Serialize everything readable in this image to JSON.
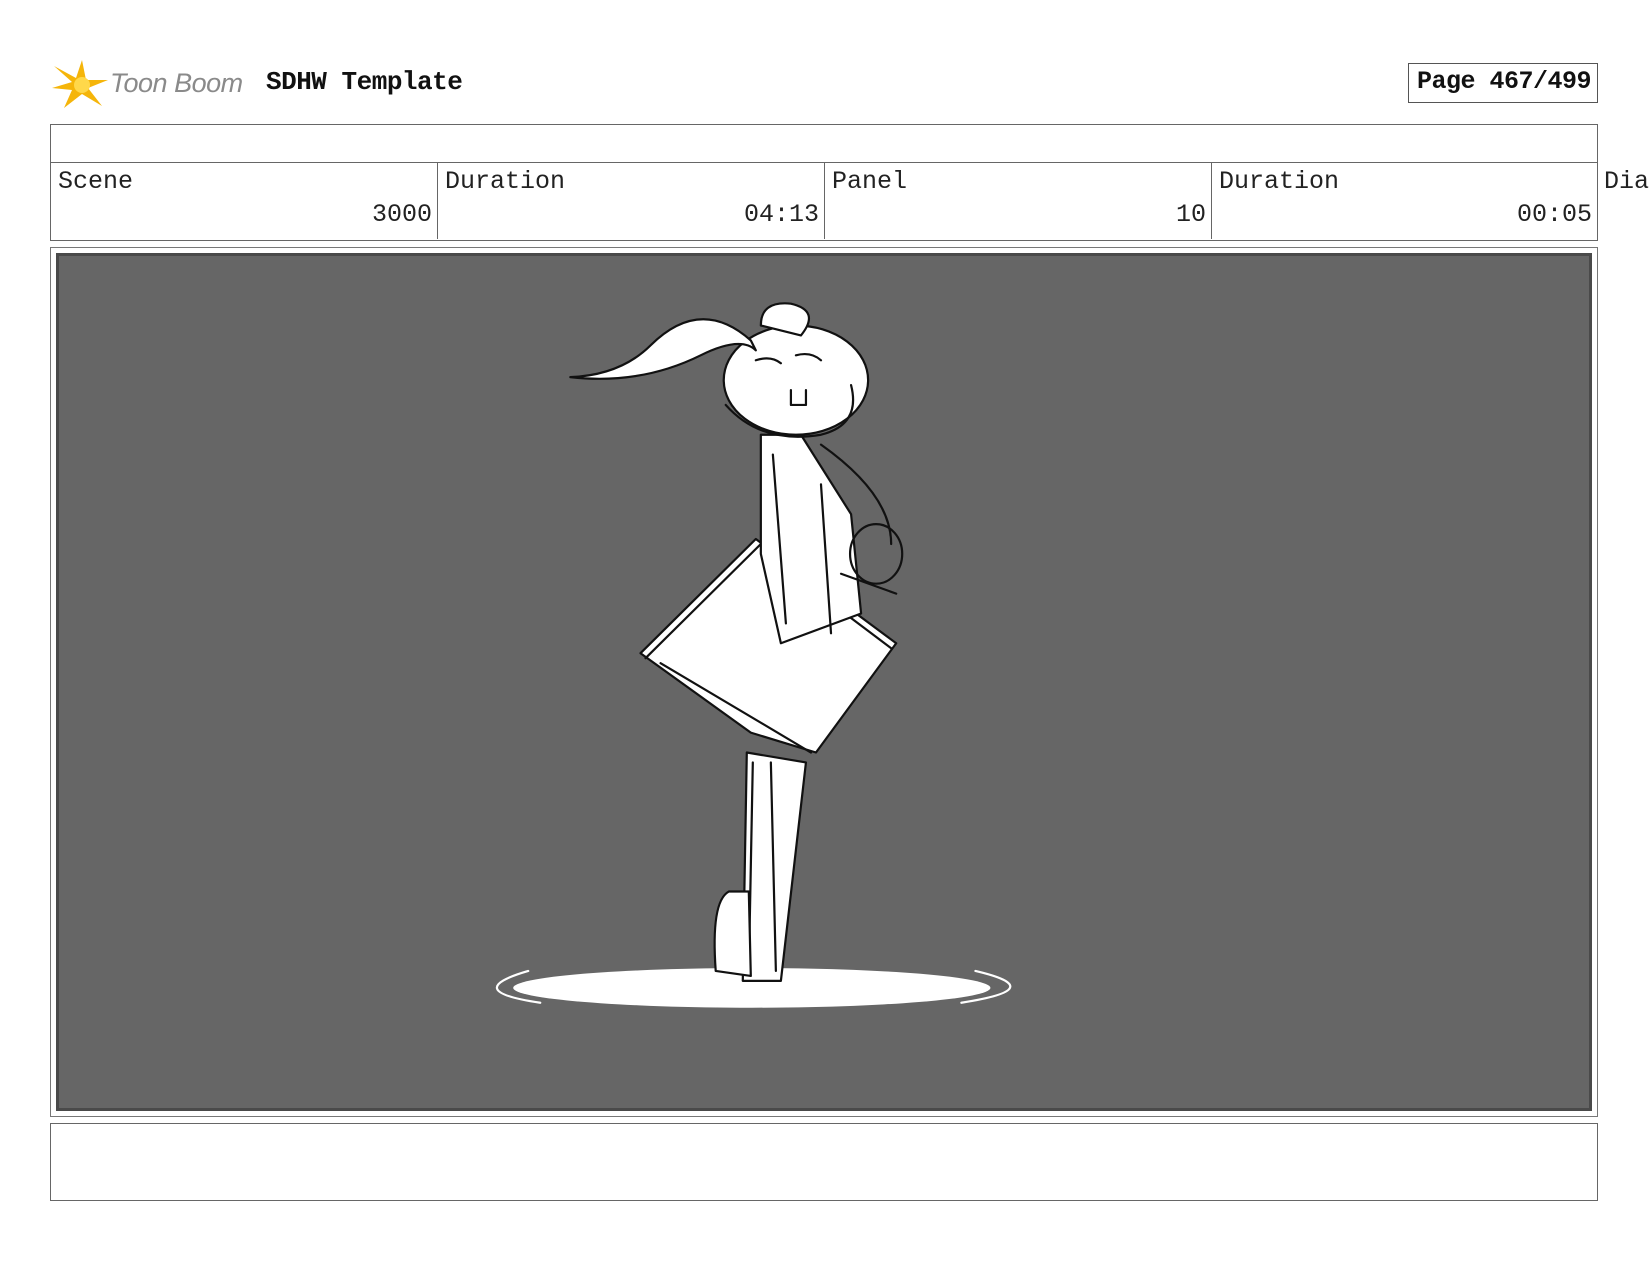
{
  "header": {
    "logo_text": "Toon Boom",
    "logo_icon": "sunburst-star-icon",
    "title": "SDHW Template",
    "page_label": "Page 467/499"
  },
  "info": {
    "cells": [
      {
        "label": "Scene",
        "value": "3000"
      },
      {
        "label": "Duration",
        "value": "04:13"
      },
      {
        "label": "Panel",
        "value": "10"
      },
      {
        "label": "Duration",
        "value": "00:05"
      }
    ],
    "overflow_label": "Dia"
  },
  "panel": {
    "image": "rabbit-character-sketch",
    "background_color": "#666666",
    "sketch_color": "#ffffff",
    "line_color": "#111111"
  },
  "colors": {
    "logo_star": "#f5b50a",
    "logo_text": "#8a8a8a",
    "border": "#666666"
  }
}
